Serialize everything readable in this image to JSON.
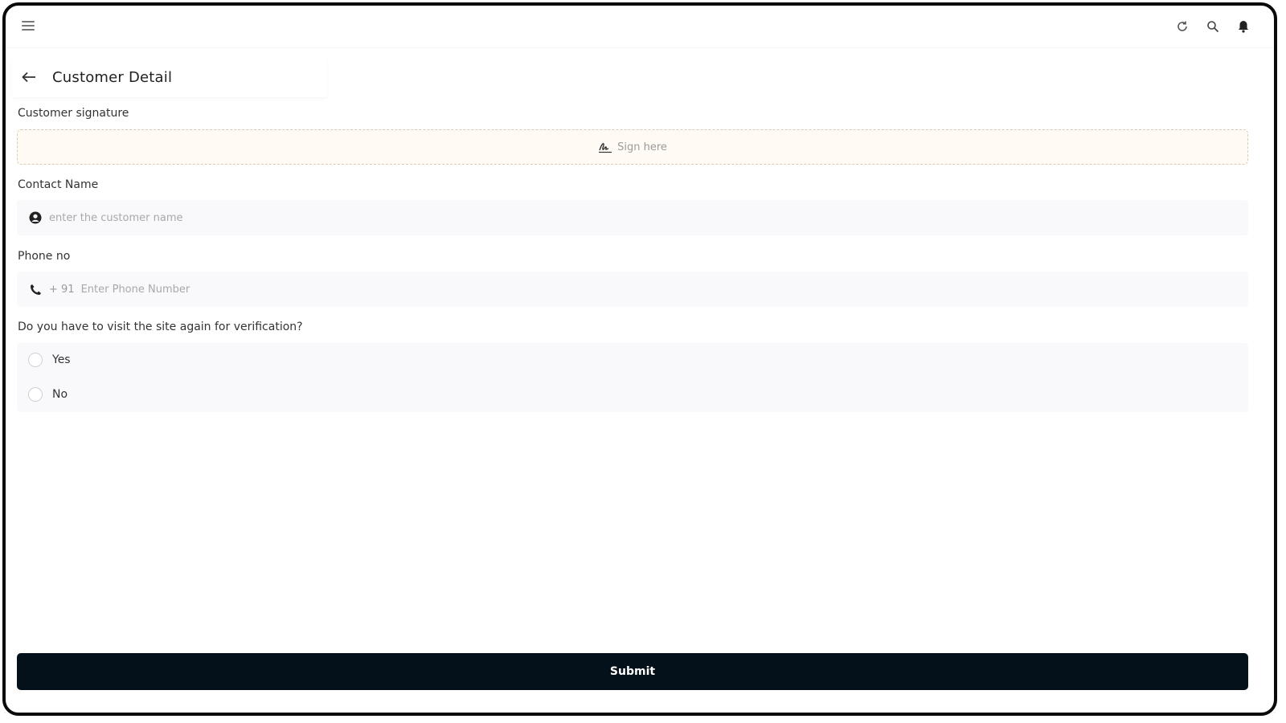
{
  "header": {
    "title": "Customer Detail",
    "icons": [
      "menu-icon",
      "refresh-icon",
      "search-icon",
      "bell-icon",
      "back-arrow-icon"
    ]
  },
  "signature": {
    "label": "Customer signature",
    "placeholder": "Sign here",
    "icon": "signature-icon"
  },
  "contact_name": {
    "label": "Contact Name",
    "placeholder": "enter the customer name",
    "value": "",
    "icon": "user-circle-icon"
  },
  "phone": {
    "label": "Phone no",
    "prefix": "+ 91",
    "placeholder": "Enter Phone Number",
    "value": "",
    "icon": "phone-icon"
  },
  "revisit": {
    "question": "Do you  have to visit the site again for verification?",
    "options": [
      {
        "label": "Yes",
        "selected": false
      },
      {
        "label": "No",
        "selected": false
      }
    ]
  },
  "submit_label": "Submit",
  "colors": {
    "primary": "#04101a",
    "signature_bg": "#fffaf3",
    "field_bg": "#f9f9fc"
  }
}
